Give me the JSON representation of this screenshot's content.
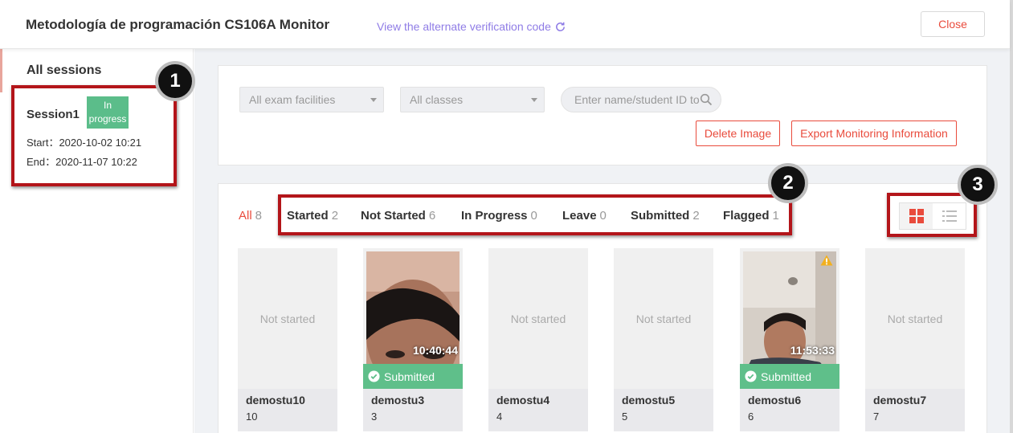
{
  "header": {
    "title": "Metodología de programación CS106A  Monitor",
    "alt_code_link": "View the alternate verification code",
    "close_label": "Close"
  },
  "sidebar": {
    "heading": "All sessions",
    "session": {
      "name": "Session1",
      "status": "In progress",
      "start": "Start：2020-10-02 10:21",
      "end": "End：2020-11-07 10:22"
    }
  },
  "filters": {
    "facility_placeholder": "All exam facilities",
    "class_placeholder": "All classes",
    "search_placeholder": "Enter name/student ID to",
    "delete_image_label": "Delete Image",
    "export_label": "Export Monitoring Information"
  },
  "tabs": [
    {
      "label": "All",
      "count": "8"
    },
    {
      "label": "Started",
      "count": "2"
    },
    {
      "label": "Not Started",
      "count": "6"
    },
    {
      "label": "In Progress",
      "count": "0"
    },
    {
      "label": "Leave",
      "count": "0"
    },
    {
      "label": "Submitted",
      "count": "2"
    },
    {
      "label": "Flagged",
      "count": "1"
    }
  ],
  "students": [
    {
      "name": "demostu10",
      "id": "10",
      "status": "Not started"
    },
    {
      "name": "demostu3",
      "id": "3",
      "time": "10:40:44",
      "status": "Submitted"
    },
    {
      "name": "demostu4",
      "id": "4",
      "status": "Not started"
    },
    {
      "name": "demostu5",
      "id": "5",
      "status": "Not started"
    },
    {
      "name": "demostu6",
      "id": "6",
      "time": "11:53:33",
      "status": "Submitted",
      "flagged": true
    },
    {
      "name": "demostu7",
      "id": "7",
      "status": "Not started"
    }
  ],
  "annotations": [
    "1",
    "2",
    "3"
  ],
  "colors": {
    "accent_red": "#e94b3c",
    "status_green": "#5bbd8a",
    "link_purple": "#8f7ce6",
    "annotation_red": "#b3151a"
  },
  "icons": {
    "refresh": "refresh-icon",
    "search": "search-icon",
    "grid_view": "grid-view-icon",
    "list_view": "list-view-icon",
    "check": "check-circle-icon",
    "warning": "warning-icon"
  }
}
